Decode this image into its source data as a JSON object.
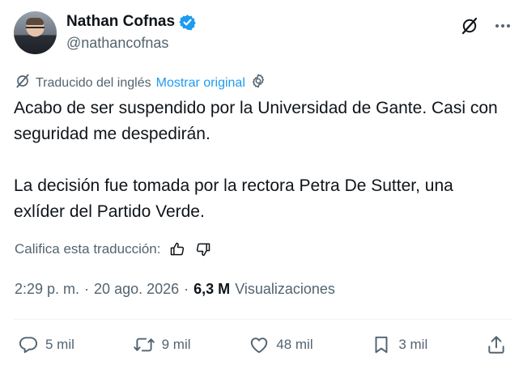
{
  "author": {
    "name": "Nathan Cofnas",
    "handle": "@nathancofnas",
    "verified": true
  },
  "translation": {
    "label": "Traducido del inglés",
    "show_original": "Mostrar original"
  },
  "tweet": {
    "paragraph1": "Acabo de ser suspendido por la Universidad de Gante. Casi con seguridad me despedirán.",
    "paragraph2": "La decisión fue tomada por la rectora Petra De Sutter, una exlíder del Partido Verde."
  },
  "rating": {
    "label": "Califica esta traducción:"
  },
  "meta": {
    "time": "2:29 p. m.",
    "separator": "·",
    "date": "20 ago. 2026",
    "views_count": "6,3 M",
    "views_label": "Visualizaciones"
  },
  "actions": {
    "replies": "5 mil",
    "reposts": "9 mil",
    "likes": "48 mil",
    "bookmarks": "3 mil"
  },
  "colors": {
    "text": "#0f1419",
    "secondary": "#536471",
    "accent": "#1d9bf0"
  }
}
